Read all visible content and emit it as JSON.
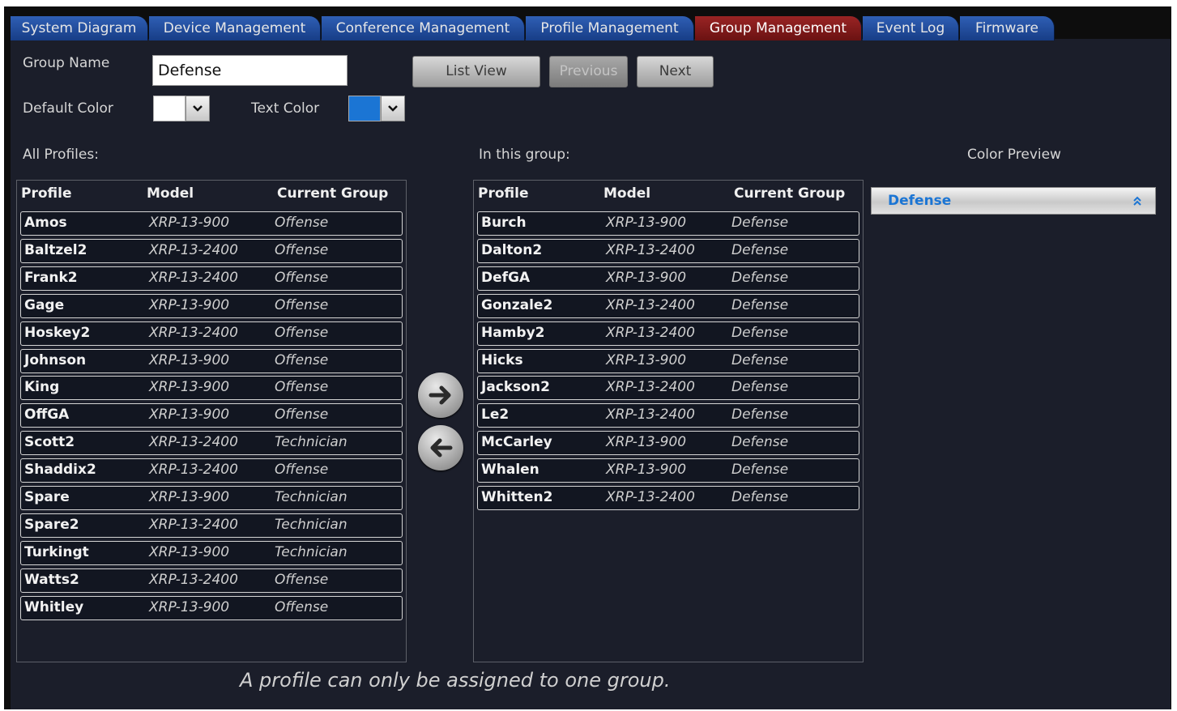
{
  "tabs": [
    "System Diagram",
    "Device Management",
    "Conference Management",
    "Profile Management",
    "Group Management",
    "Event Log",
    "Firmware"
  ],
  "active_tab": "Group Management",
  "form": {
    "group_name_label": "Group Name",
    "group_name_value": "Defense",
    "default_color_label": "Default Color",
    "default_color": "#ffffff",
    "text_color_label": "Text Color",
    "text_color": "#1b75d4"
  },
  "buttons": {
    "list_view": "List View",
    "previous": "Previous",
    "next": "Next"
  },
  "all_profiles": {
    "title": "All Profiles:",
    "columns": [
      "Profile",
      "Model",
      "Current Group"
    ],
    "rows": [
      {
        "profile": "Amos",
        "model": "XRP-13-900",
        "group": "Offense"
      },
      {
        "profile": "Baltzel2",
        "model": "XRP-13-2400",
        "group": "Offense"
      },
      {
        "profile": "Frank2",
        "model": "XRP-13-2400",
        "group": "Offense"
      },
      {
        "profile": "Gage",
        "model": "XRP-13-900",
        "group": "Offense"
      },
      {
        "profile": "Hoskey2",
        "model": "XRP-13-2400",
        "group": "Offense"
      },
      {
        "profile": "Johnson",
        "model": "XRP-13-900",
        "group": "Offense"
      },
      {
        "profile": "King",
        "model": "XRP-13-900",
        "group": "Offense"
      },
      {
        "profile": "OffGA",
        "model": "XRP-13-900",
        "group": "Offense"
      },
      {
        "profile": "Scott2",
        "model": "XRP-13-2400",
        "group": "Technician"
      },
      {
        "profile": "Shaddix2",
        "model": "XRP-13-2400",
        "group": "Offense"
      },
      {
        "profile": "Spare",
        "model": "XRP-13-900",
        "group": "Technician"
      },
      {
        "profile": "Spare2",
        "model": "XRP-13-2400",
        "group": "Technician"
      },
      {
        "profile": "Turkingt",
        "model": "XRP-13-900",
        "group": "Technician"
      },
      {
        "profile": "Watts2",
        "model": "XRP-13-2400",
        "group": "Offense"
      },
      {
        "profile": "Whitley",
        "model": "XRP-13-900",
        "group": "Offense"
      }
    ]
  },
  "in_group": {
    "title": "In this group:",
    "columns": [
      "Profile",
      "Model",
      "Current Group"
    ],
    "rows": [
      {
        "profile": "Burch",
        "model": "XRP-13-900",
        "group": "Defense"
      },
      {
        "profile": "Dalton2",
        "model": "XRP-13-2400",
        "group": "Defense"
      },
      {
        "profile": "DefGA",
        "model": "XRP-13-900",
        "group": "Defense"
      },
      {
        "profile": "Gonzale2",
        "model": "XRP-13-2400",
        "group": "Defense"
      },
      {
        "profile": "Hamby2",
        "model": "XRP-13-2400",
        "group": "Defense"
      },
      {
        "profile": "Hicks",
        "model": "XRP-13-900",
        "group": "Defense"
      },
      {
        "profile": "Jackson2",
        "model": "XRP-13-2400",
        "group": "Defense"
      },
      {
        "profile": "Le2",
        "model": "XRP-13-2400",
        "group": "Defense"
      },
      {
        "profile": "McCarley",
        "model": "XRP-13-900",
        "group": "Defense"
      },
      {
        "profile": "Whalen",
        "model": "XRP-13-900",
        "group": "Defense"
      },
      {
        "profile": "Whitten2",
        "model": "XRP-13-2400",
        "group": "Defense"
      }
    ]
  },
  "preview": {
    "title": "Color Preview",
    "label": "Defense",
    "icon": "chevron-double-up-icon"
  },
  "icons": {
    "add": "arrow-right-icon",
    "remove": "arrow-left-icon",
    "dropdown": "chevron-down-icon"
  },
  "footer_note": "A profile can only be assigned to one group."
}
